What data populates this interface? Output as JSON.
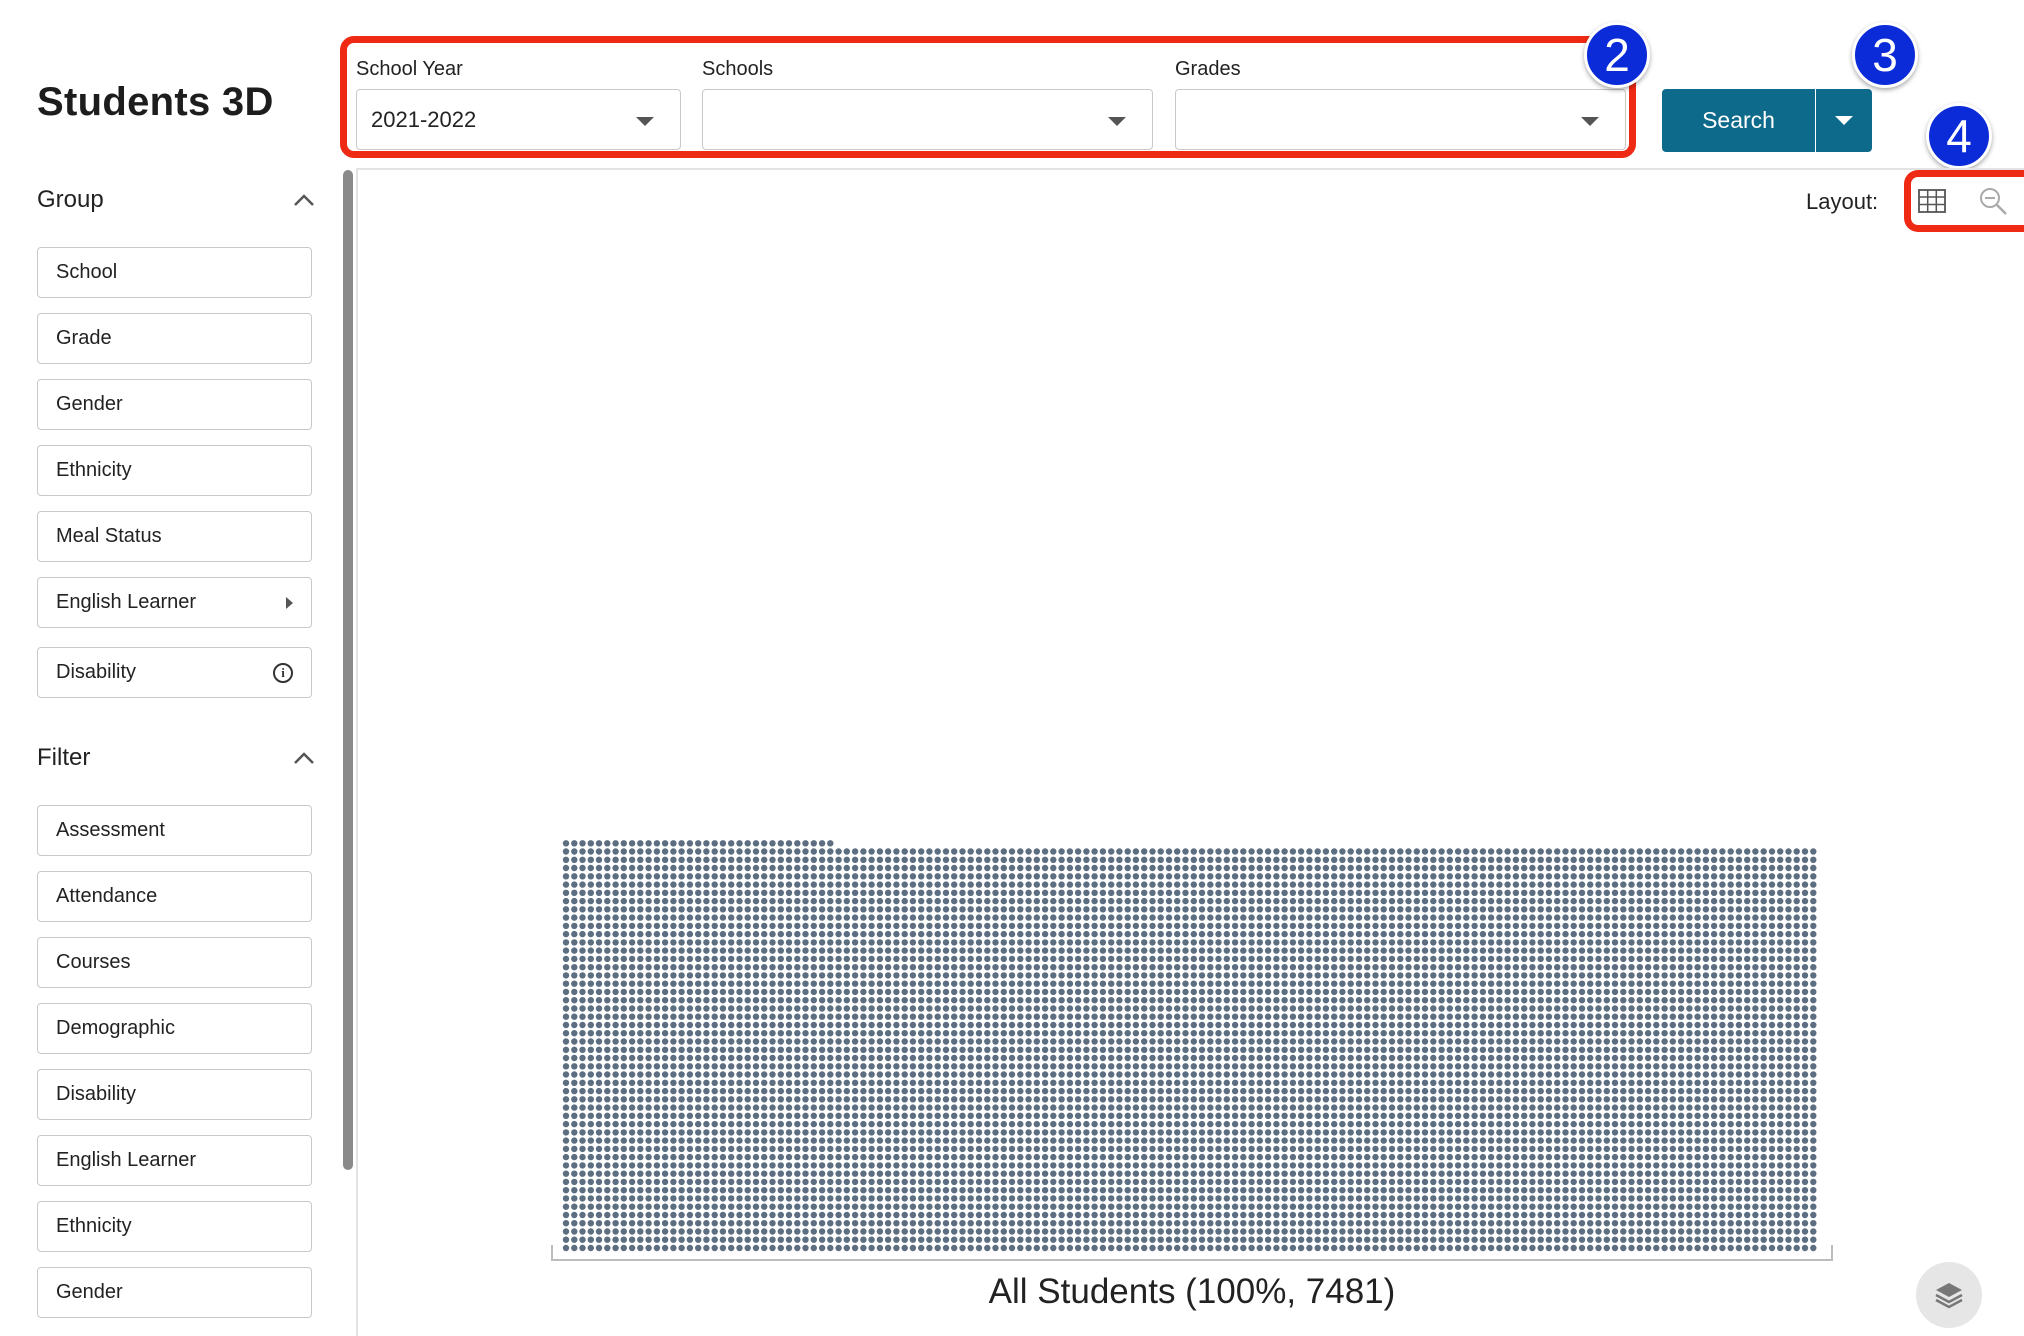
{
  "app": {
    "title": "Students 3D"
  },
  "sidebar": {
    "group": {
      "heading": "Group",
      "items": [
        {
          "label": "School"
        },
        {
          "label": "Grade"
        },
        {
          "label": "Gender"
        },
        {
          "label": "Ethnicity"
        },
        {
          "label": "Meal Status"
        },
        {
          "label": "English Learner",
          "icon": "caret-right-icon"
        },
        {
          "label": "Disability",
          "icon": "info-icon"
        }
      ]
    },
    "filter": {
      "heading": "Filter",
      "items": [
        {
          "label": "Assessment"
        },
        {
          "label": "Attendance"
        },
        {
          "label": "Courses"
        },
        {
          "label": "Demographic"
        },
        {
          "label": "Disability"
        },
        {
          "label": "English Learner"
        },
        {
          "label": "Ethnicity"
        },
        {
          "label": "Gender"
        }
      ]
    }
  },
  "filters": {
    "school_year": {
      "label": "School Year",
      "value": "2021-2022"
    },
    "schools": {
      "label": "Schools",
      "value": ""
    },
    "grades": {
      "label": "Grades",
      "value": ""
    }
  },
  "search": {
    "label": "Search"
  },
  "callouts": [
    "2",
    "3",
    "4"
  ],
  "layout_control": {
    "label": "Layout:",
    "options": [
      {
        "icon": "grid-icon"
      },
      {
        "icon": "zoom-icon"
      }
    ]
  },
  "visualization": {
    "caption": "All Students (100%, 7481)",
    "total_students": 7481,
    "percent": 100,
    "dot_color": "#5d6e81"
  },
  "colors": {
    "accent": "#0d6a8a",
    "callout": "#0b2bd9",
    "highlight_box": "#ee2a14"
  }
}
